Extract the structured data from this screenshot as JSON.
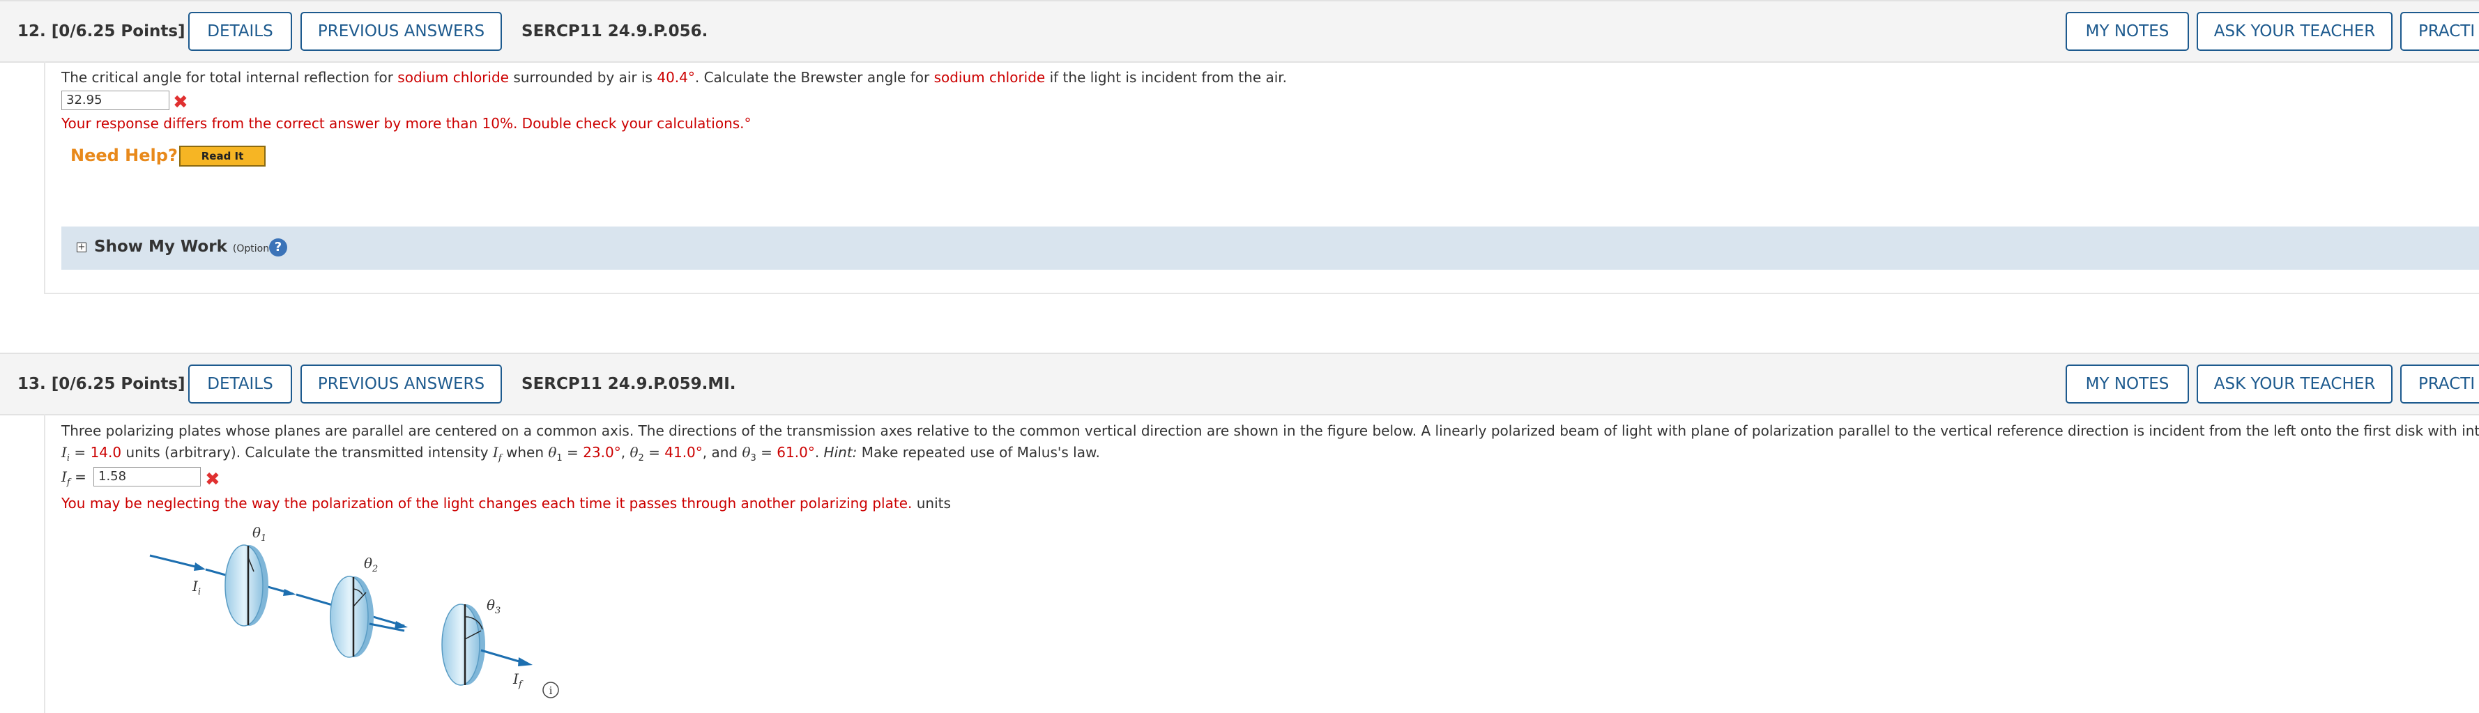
{
  "q12": {
    "number": "12.",
    "points": "[0/6.25 Points]",
    "details_label": "DETAILS",
    "prev_answers_label": "PREVIOUS ANSWERS",
    "code": "SERCP11 24.9.P.056.",
    "my_notes_label": "MY NOTES",
    "ask_teacher_label": "ASK YOUR TEACHER",
    "practice_label": "PRACTI",
    "question": {
      "t1": "The critical angle for total internal reflection for ",
      "material1": "sodium chloride",
      "t2": " surrounded by air is ",
      "angle": "40.4°",
      "t3": ". Calculate the Brewster angle for ",
      "material2": "sodium chloride",
      "t4": " if the light is incident from the air."
    },
    "answer_value": "32.95",
    "error_text": "Your response differs from the correct answer by more than 10%. Double check your calculations.°",
    "need_help": "Need Help?",
    "read_it": "Read It",
    "show_work": "Show My Work",
    "optional": "(Optional)",
    "help_icon": "?"
  },
  "q13": {
    "number": "13.",
    "points": "[0/6.25 Points]",
    "details_label": "DETAILS",
    "prev_answers_label": "PREVIOUS ANSWERS",
    "code": "SERCP11 24.9.P.059.MI.",
    "my_notes_label": "MY NOTES",
    "ask_teacher_label": "ASK YOUR TEACHER",
    "practice_label": "PRACTI",
    "line1": "Three polarizing plates whose planes are parallel are centered on a common axis. The directions of the transmission axes relative to the common vertical direction are shown in the figure below. A linearly polarized beam of light with plane of polarization parallel to the vertical reference direction is incident from the left onto the first disk with intensity",
    "line2": {
      "Ii": "I",
      "Ii_sub": "i",
      "eq": " = ",
      "Ii_val": "14.0",
      "t1": " units (arbitrary). Calculate the transmitted intensity ",
      "If": "I",
      "If_sub": "f",
      "t2": " when ",
      "th": "θ",
      "sub1": "1",
      "eq1": " = ",
      "v1": "23.0°",
      "c1": ", ",
      "sub2": "2",
      "eq2": " = ",
      "v2": "41.0°",
      "c2": ", and ",
      "sub3": "3",
      "eq3": " = ",
      "v3": "61.0°",
      "t3": ". ",
      "hint": "Hint:",
      "t4": " Make repeated use of Malus's law."
    },
    "answer_label_sub": "f",
    "answer_eq": " = ",
    "answer_value": "1.58",
    "error_text": "You may be neglecting the way the polarization of the light changes each time it passes through another polarizing plate.",
    "units": " units",
    "figure": {
      "theta1": "θ",
      "theta1_sub": "1",
      "theta2": "θ",
      "theta2_sub": "2",
      "theta3": "θ",
      "theta3_sub": "3",
      "Ii": "I",
      "Ii_sub": "i",
      "If": "I",
      "If_sub": "f",
      "info": "i"
    }
  }
}
